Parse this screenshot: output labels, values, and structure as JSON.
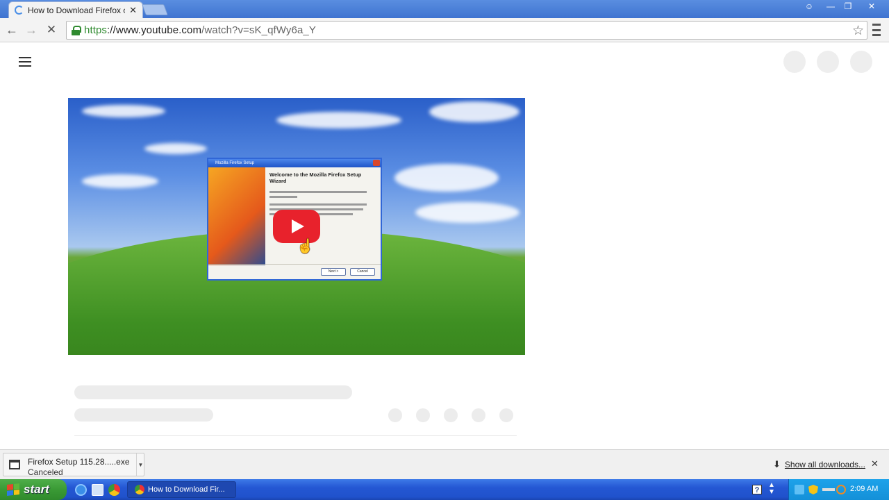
{
  "browser": {
    "tab_title": "How to Download Firefox on",
    "tab_close": "✕",
    "url_scheme": "https",
    "url_host": "://www.youtube.com",
    "url_path": "/watch?v=sK_qfWy6a_Y",
    "window_controls": {
      "minimize": "—",
      "maximize": "❐",
      "close": "✕"
    }
  },
  "video": {
    "dialog_title": "Mozilla Firefox Setup",
    "dialog_heading": "Welcome to the Mozilla Firefox Setup Wizard",
    "next_label": "Next >",
    "cancel_label": "Cancel"
  },
  "downloads": {
    "item_name": "Firefox Setup 115.28.....exe",
    "item_status": "Canceled",
    "show_all_label": "Show all downloads...",
    "close": "✕"
  },
  "taskbar": {
    "start_label": "start",
    "task_label": "How to Download Fir...",
    "help": "?",
    "clock": "2:09 AM"
  },
  "colors": {
    "youtube_red": "#e8222c",
    "secure_green": "#2f8a2f",
    "xp_blue": "#2457d3",
    "xp_start_green": "#3a9a35"
  }
}
